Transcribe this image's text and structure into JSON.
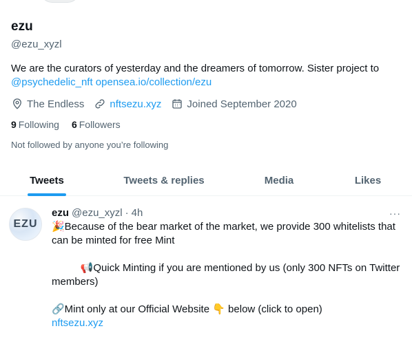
{
  "profile": {
    "display_name": "ezu",
    "handle": "@ezu_xyzl",
    "bio_text": "We are the curators of yesterday and the dreamers of tomorrow. Sister project to",
    "bio_mention": "@psychedelic_nft",
    "bio_link": "opensea.io/collection/ezu",
    "location": "The Endless",
    "website": "nftsezu.xyz",
    "joined": "Joined September 2020",
    "following_count": "9",
    "following_label": "Following",
    "followers_count": "6",
    "followers_label": "Followers",
    "followed_note": "Not followed by anyone you’re following"
  },
  "tabs": [
    "Tweets",
    "Tweets & replies",
    "Media",
    "Likes"
  ],
  "tweet": {
    "avatar_text": "EZU",
    "name": "ezu",
    "handle": "@ezu_xyzl",
    "separator": "·",
    "time": "4h",
    "more": "···",
    "line1": "🎉Because of the bear market of the market, we provide 300 whitelists that can be minted for free Mint",
    "line2": "          📢Quick Minting if you are mentioned by us (only 300 NFTs on Twitter members)",
    "line3": "🔗Mint only at our Official Website 👇 below (click to open)",
    "link": "nftsezu.xyz"
  },
  "colors": {
    "accent": "#1d9bf0",
    "muted": "#536471",
    "text": "#0f1419"
  }
}
